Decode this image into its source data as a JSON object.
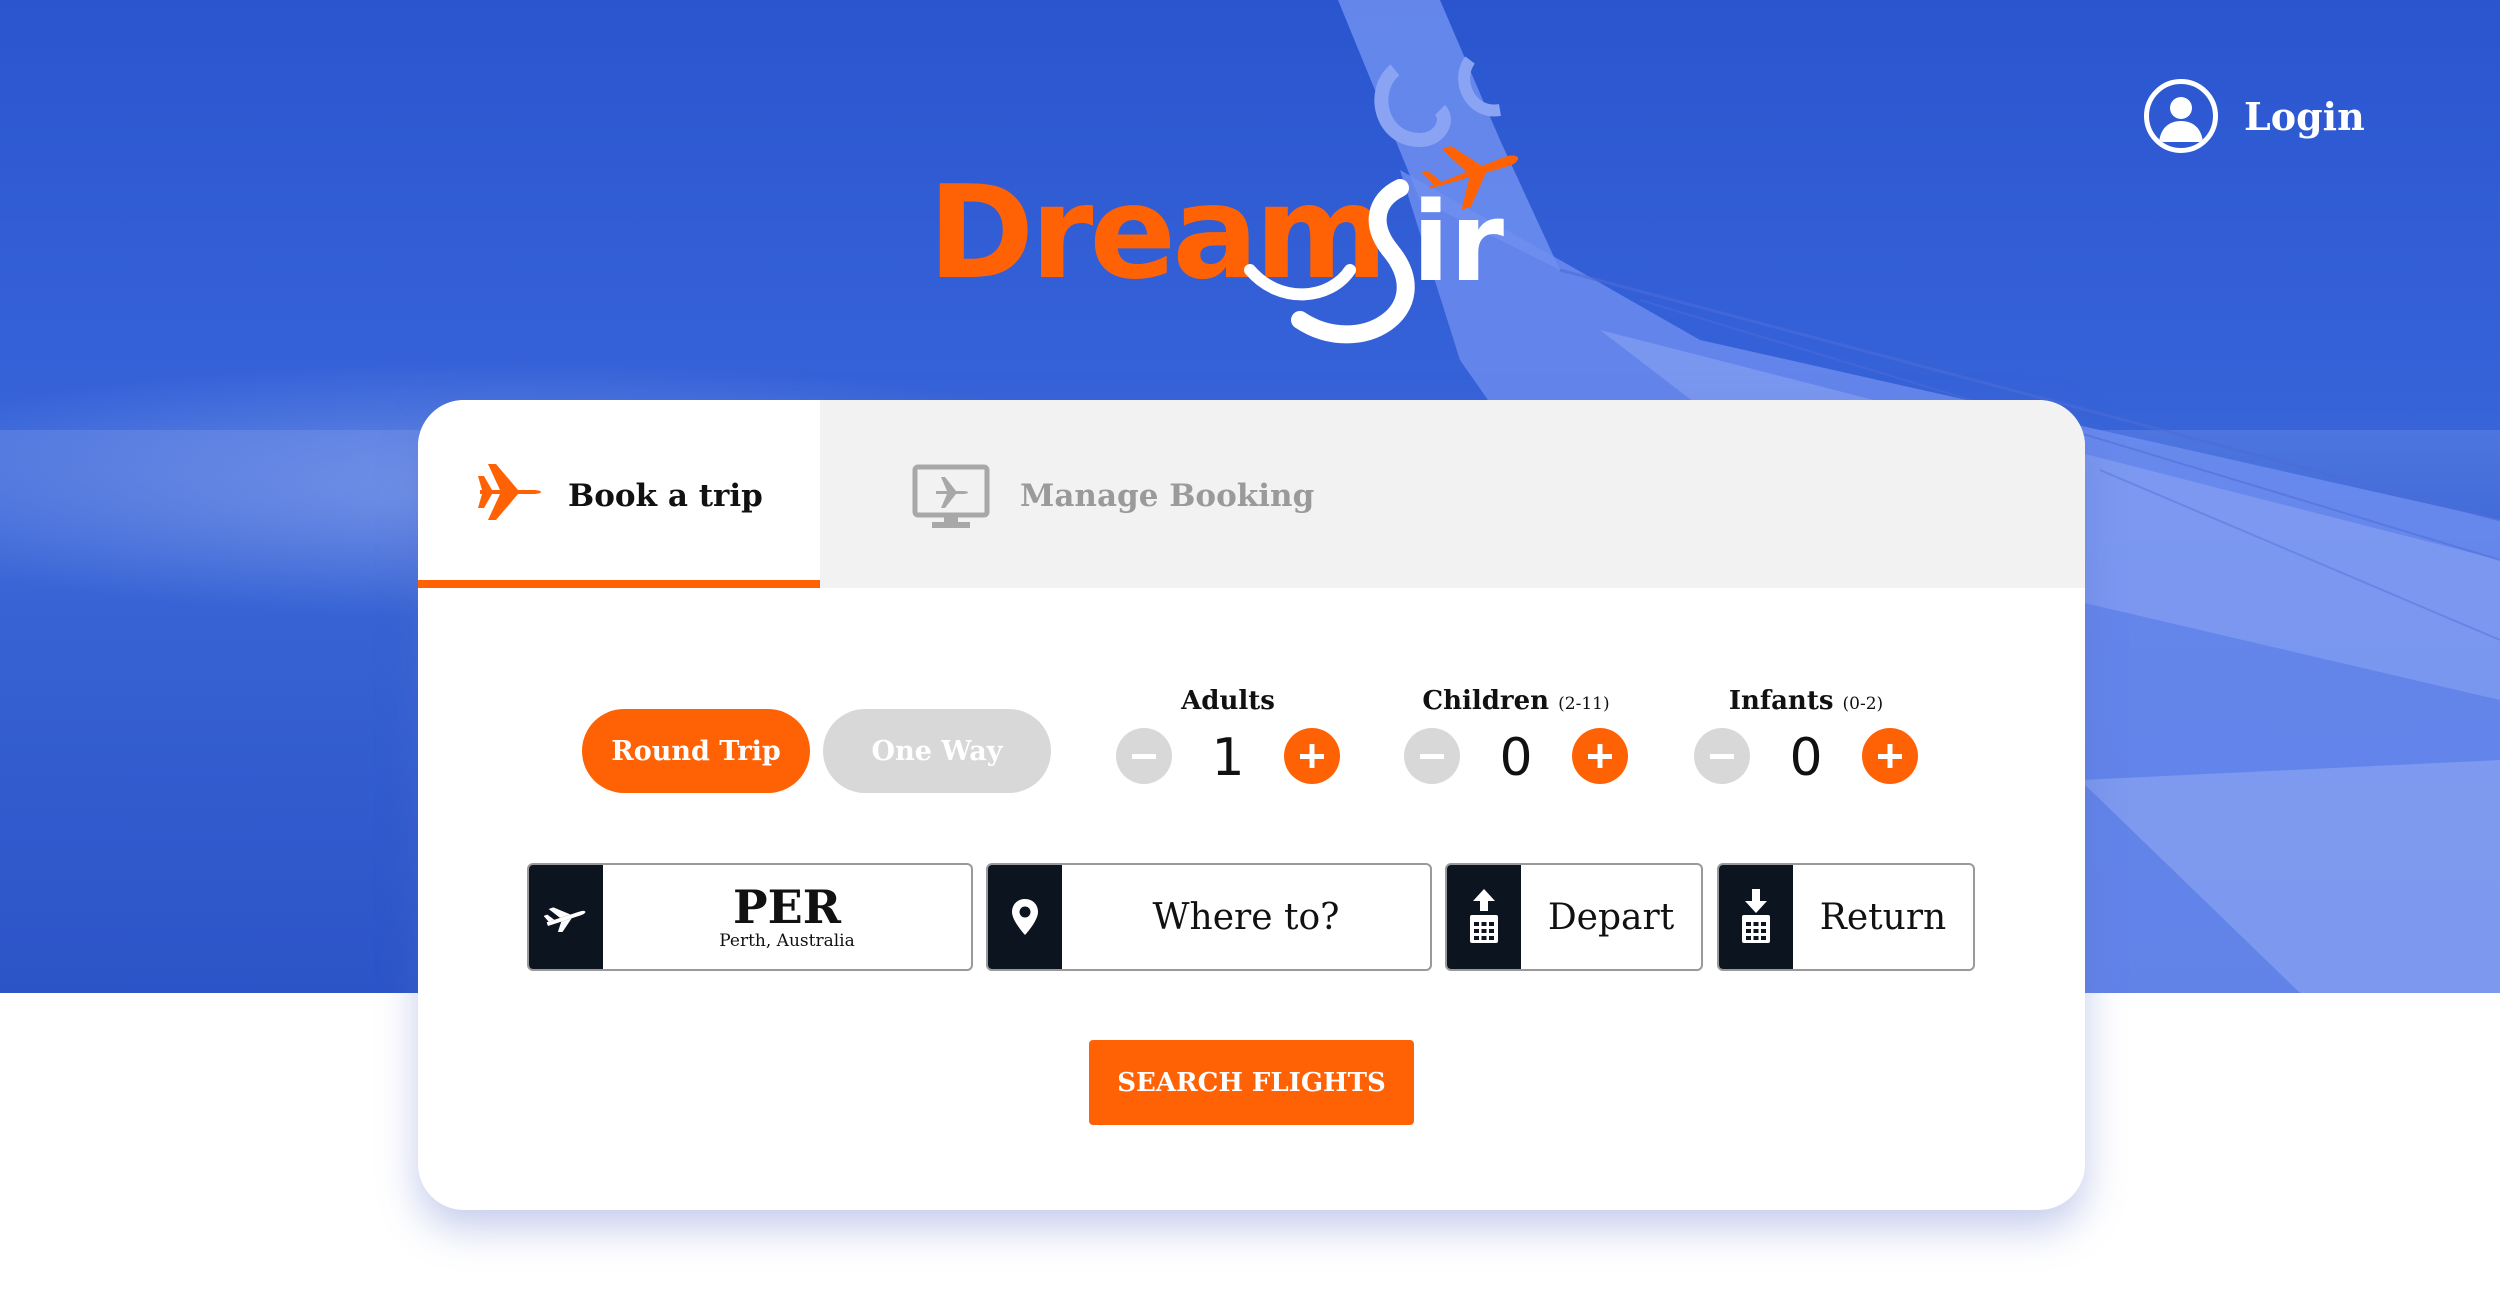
{
  "brand": {
    "name_part1": "Dream",
    "name_part2": "Air",
    "accent_color": "#ff6205",
    "hero_color": "#3561d8"
  },
  "header": {
    "login_label": "Login",
    "login_icon": "user-icon"
  },
  "tabs": [
    {
      "label": "Book a trip",
      "icon": "airplane-icon",
      "active": true
    },
    {
      "label": "Manage Booking",
      "icon": "monitor-airplane-icon",
      "active": false
    }
  ],
  "trip_type": {
    "round_trip": "Round Trip",
    "one_way": "One Way",
    "selected": "Round Trip"
  },
  "passengers": {
    "adults": {
      "label": "Adults",
      "range": "",
      "value": "1"
    },
    "children": {
      "label": "Children",
      "range": "(2-11)",
      "value": "0"
    },
    "infants": {
      "label": "Infants",
      "range": "(0-2)",
      "value": "0"
    }
  },
  "fields": {
    "from": {
      "code": "PER",
      "city": "Perth, Australia",
      "icon": "departing-plane-icon"
    },
    "to": {
      "placeholder": "Where to?",
      "icon": "map-pin-icon"
    },
    "depart": {
      "label": "Depart",
      "icon": "calendar-depart-icon"
    },
    "return": {
      "label": "Return",
      "icon": "calendar-return-icon"
    }
  },
  "search_button": "SEARCH FLIGHTS"
}
